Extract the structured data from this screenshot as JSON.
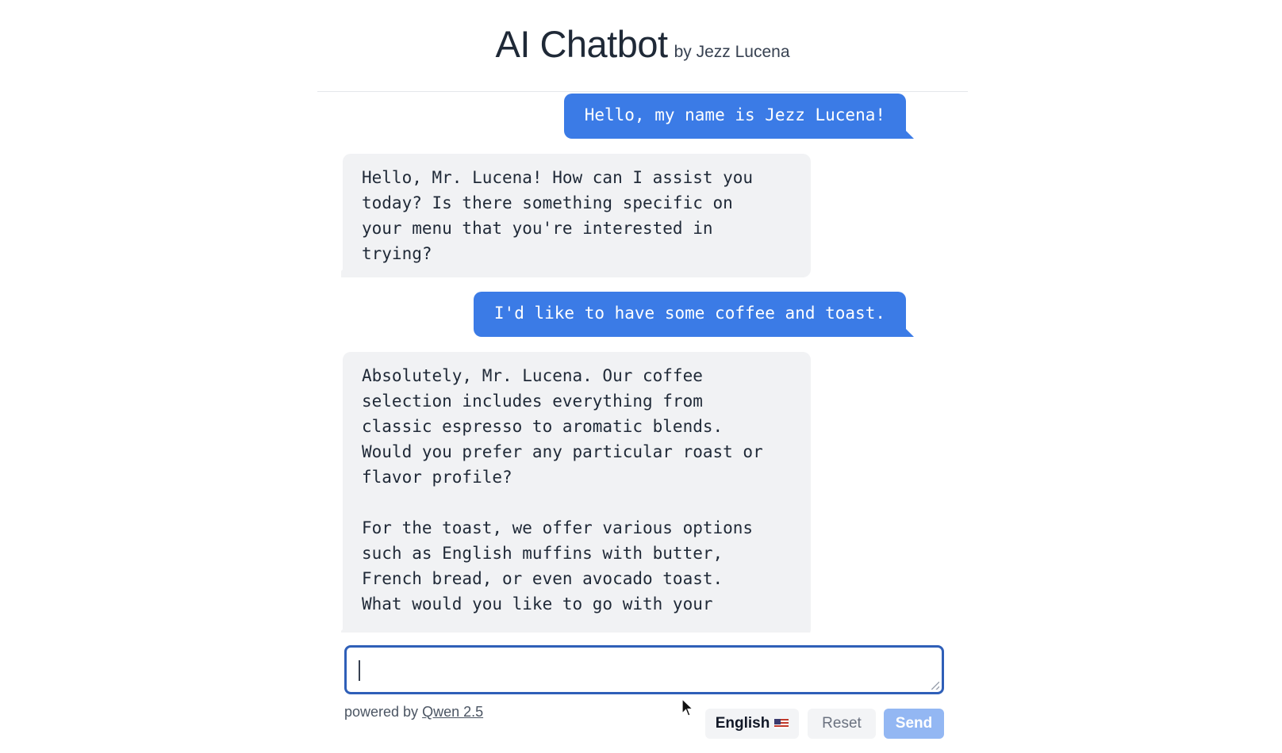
{
  "header": {
    "title": "AI Chatbot",
    "subtitle": "by Jezz Lucena"
  },
  "messages": [
    {
      "role": "user",
      "text": "Hello, my name is Jezz Lucena!"
    },
    {
      "role": "assistant",
      "text": "Hello, Mr. Lucena! How can I assist you\ntoday? Is there something specific on\nyour menu that you're interested in\ntrying?"
    },
    {
      "role": "user",
      "text": "I'd like to have some coffee and toast."
    },
    {
      "role": "assistant",
      "text": "Absolutely, Mr. Lucena. Our coffee\nselection includes everything from\nclassic espresso to aromatic blends.\nWould you prefer any particular roast or\nflavor profile?\n\nFor the toast, we offer various options\nsuch as English muffins with butter,\nFrench bread, or even avocado toast.\nWhat would you like to go with your"
    }
  ],
  "input": {
    "value": "",
    "placeholder": ""
  },
  "footer": {
    "powered_prefix": "powered by",
    "powered_link": "Qwen 2.5"
  },
  "controls": {
    "language_label": "English",
    "language_icon": "us-flag-icon",
    "reset_label": "Reset",
    "send_label": "Send"
  },
  "colors": {
    "user_bubble": "#3b7be6",
    "bot_bubble": "#f1f2f4",
    "input_border": "#2f5fb8",
    "send_button": "#93b7f3"
  }
}
